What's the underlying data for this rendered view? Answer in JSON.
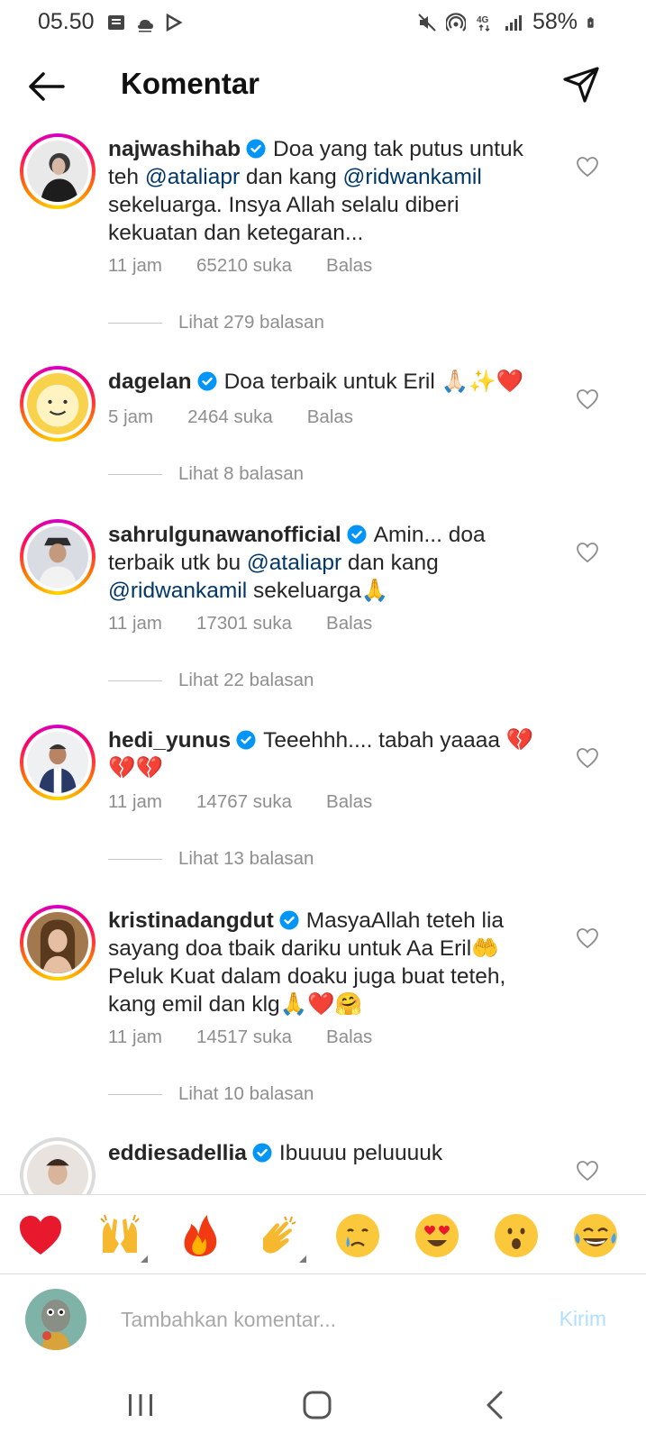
{
  "status_bar": {
    "time": "05.50",
    "battery": "58%",
    "left_icons": [
      "message-icon",
      "weather-icon",
      "play-store-icon"
    ],
    "right_icons": [
      "mute-icon",
      "hotspot-icon",
      "4g-icon",
      "signal-icon",
      "battery-icon"
    ]
  },
  "header": {
    "title": "Komentar",
    "back_icon": "arrow-left-icon",
    "send_icon": "direct-send-icon"
  },
  "comments": [
    {
      "username": "najwashihab",
      "verified": true,
      "text_parts": [
        {
          "t": "Doa yang tak putus untuk teh "
        },
        {
          "t": "@ataliapr",
          "mention": true
        },
        {
          "t": " dan kang "
        },
        {
          "t": "@ridwankamil",
          "mention": true
        },
        {
          "t": " sekeluarga. Insya Allah selalu diberi kekuatan dan ketegaran..."
        }
      ],
      "time": "11 jam",
      "likes": "65210 suka",
      "reply_label": "Balas",
      "view_replies": "Lihat 279 balasan"
    },
    {
      "username": "dagelan",
      "verified": true,
      "text_parts": [
        {
          "t": "Doa terbaik untuk Eril 🙏🏻✨❤️"
        }
      ],
      "time": "5 jam",
      "likes": "2464 suka",
      "reply_label": "Balas",
      "view_replies": "Lihat 8 balasan"
    },
    {
      "username": "sahrulgunawanofficial",
      "verified": true,
      "text_parts": [
        {
          "t": "Amin... doa terbaik utk bu "
        },
        {
          "t": "@ataliapr",
          "mention": true
        },
        {
          "t": " dan kang "
        },
        {
          "t": "@ridwankamil",
          "mention": true
        },
        {
          "t": " sekeluarga🙏"
        }
      ],
      "time": "11 jam",
      "likes": "17301 suka",
      "reply_label": "Balas",
      "view_replies": "Lihat 22 balasan"
    },
    {
      "username": "hedi_yunus",
      "verified": true,
      "text_parts": [
        {
          "t": "Teeehhh.... tabah yaaaa 💔💔💔"
        }
      ],
      "time": "11 jam",
      "likes": "14767 suka",
      "reply_label": "Balas",
      "view_replies": "Lihat 13 balasan"
    },
    {
      "username": "kristinadangdut",
      "verified": true,
      "text_parts": [
        {
          "t": "MasyaAllah teteh lia sayang doa tbaik dariku untuk Aa Eril🤲 Peluk Kuat dalam doaku juga buat teteh, kang emil dan klg🙏❤️🤗"
        }
      ],
      "time": "11 jam",
      "likes": "14517 suka",
      "reply_label": "Balas",
      "view_replies": "Lihat 10 balasan"
    },
    {
      "username": "eddiesadellia",
      "verified": true,
      "text_parts": [
        {
          "t": "Ibuuuu peluuuuk"
        }
      ],
      "time": "",
      "likes": "",
      "reply_label": "",
      "view_replies": ""
    }
  ],
  "emoji_bar": [
    "❤️",
    "🙌",
    "🔥",
    "👏",
    "😢",
    "😍",
    "😮",
    "😂"
  ],
  "comment_input": {
    "placeholder": "Tambahkan komentar...",
    "post_label": "Kirim"
  },
  "nav_bar": [
    "recents-icon",
    "home-icon",
    "back-icon"
  ],
  "colors": {
    "text": "#262626",
    "secondary": "#8e8e8e",
    "mention": "#00376b",
    "verified": "#0095f6",
    "post_disabled": "#b2dffc"
  }
}
